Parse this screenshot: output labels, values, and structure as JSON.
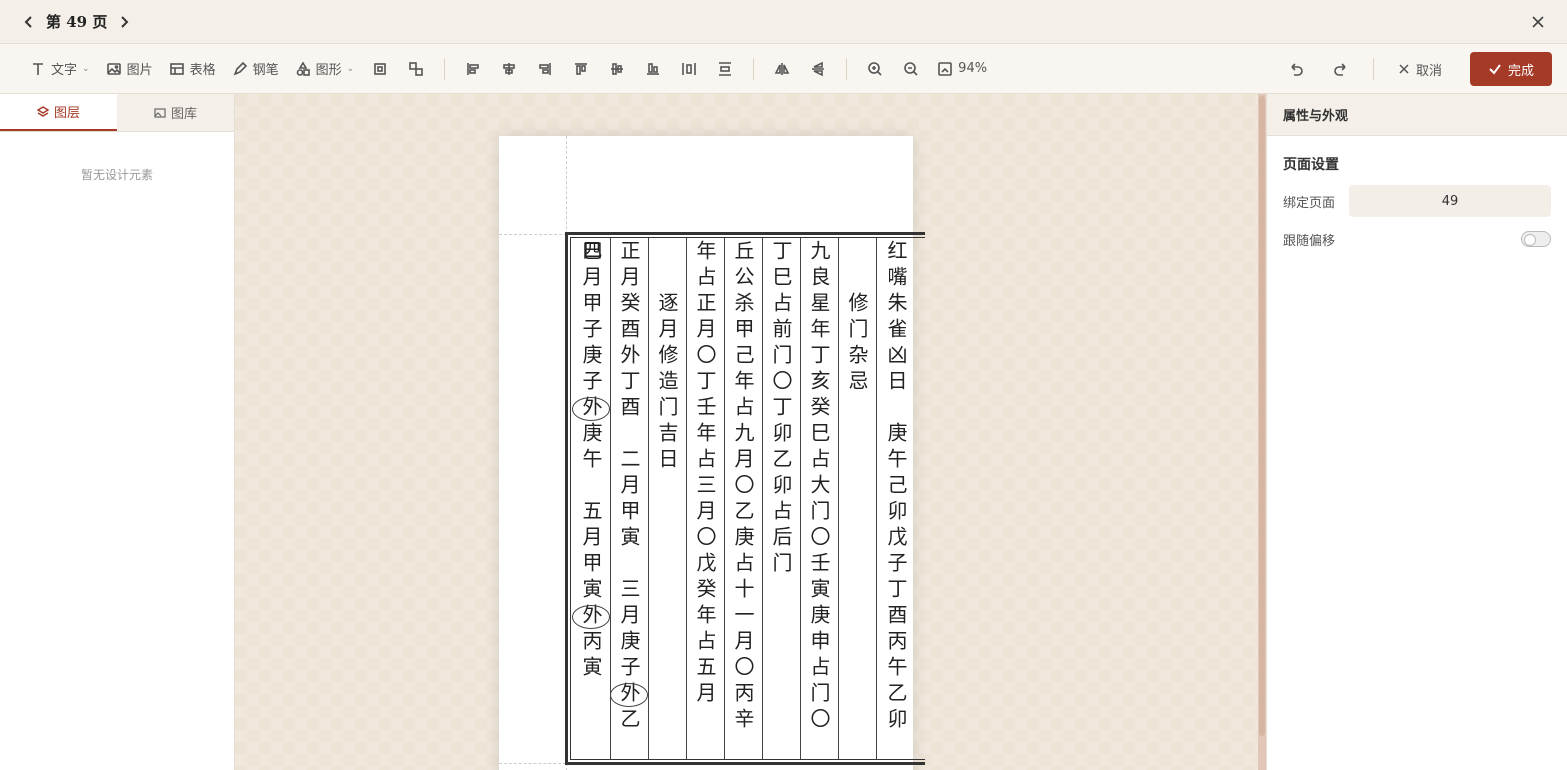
{
  "titlebar": {
    "page_label": "第 49 页"
  },
  "toolbar": {
    "text_label": "文字",
    "image_label": "图片",
    "table_label": "表格",
    "pen_label": "钢笔",
    "shape_label": "图形",
    "zoom_value": "94%",
    "cancel_label": "取消",
    "done_label": "完成"
  },
  "left_panel": {
    "tab_layers": "图层",
    "tab_library": "图库",
    "empty_text": "暂无设计元素"
  },
  "document": {
    "columns": [
      "红嘴朱雀凶日　庚午己卯戊子丁酉丙午乙卯",
      "修门杂忌",
      "九良星年丁亥癸巳占大门〇壬寅庚申占门〇丁",
      "巳占前门〇丁卯乙卯占后门",
      "丘公杀甲己年占九月〇乙庚占十一月〇丙辛年",
      "占正月〇丁壬年占三月〇戊癸年占五月",
      "逐月修造门吉日",
      "正月癸酉外丁酉　二月甲寅　三月庚子外乙巳",
      "四月甲子庚子外庚午　五月甲寅外丙寅"
    ]
  },
  "right_panel": {
    "title": "属性与外观",
    "section_title": "页面设置",
    "bind_page_label": "绑定页面",
    "bind_page_value": "49",
    "follow_offset_label": "跟随偏移"
  }
}
